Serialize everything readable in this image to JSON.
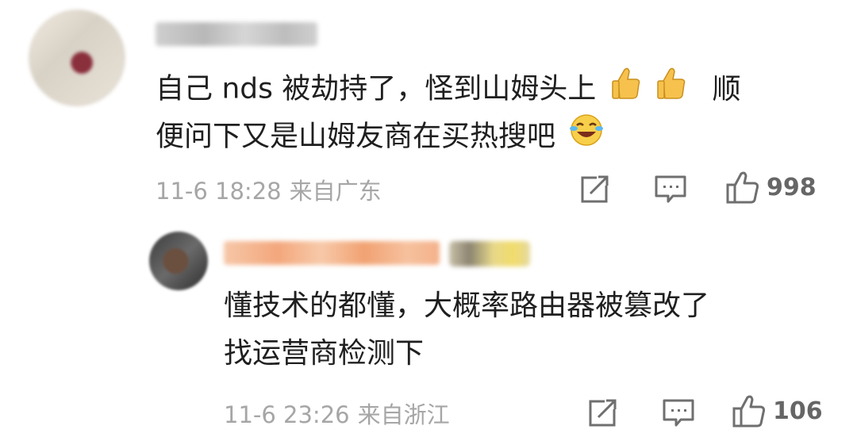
{
  "comments": [
    {
      "text_line1": "自己 nds 被劫持了，怪到山姆头上",
      "text_line1_tail": "顺",
      "text_line2": "便问下又是山姆友商在买热搜吧",
      "time": "11-6 18:28",
      "location": "来自广东",
      "likes": "998",
      "emojis": [
        "thumbs-up",
        "thumbs-up",
        "laughing-crying"
      ]
    },
    {
      "text_line1": "懂技术的都懂，大概率路由器被篡改了",
      "text_line2": "找运营商检测下",
      "time": "11-6 23:26",
      "location": "来自浙江",
      "likes": "106"
    }
  ],
  "icons": {
    "share": "share-icon",
    "comment": "comment-icon",
    "like": "thumbs-up-outline-icon"
  },
  "colors": {
    "meta_text": "#a6a6a6",
    "icon": "#6f6f6f",
    "body_text": "#1f1f1f"
  }
}
